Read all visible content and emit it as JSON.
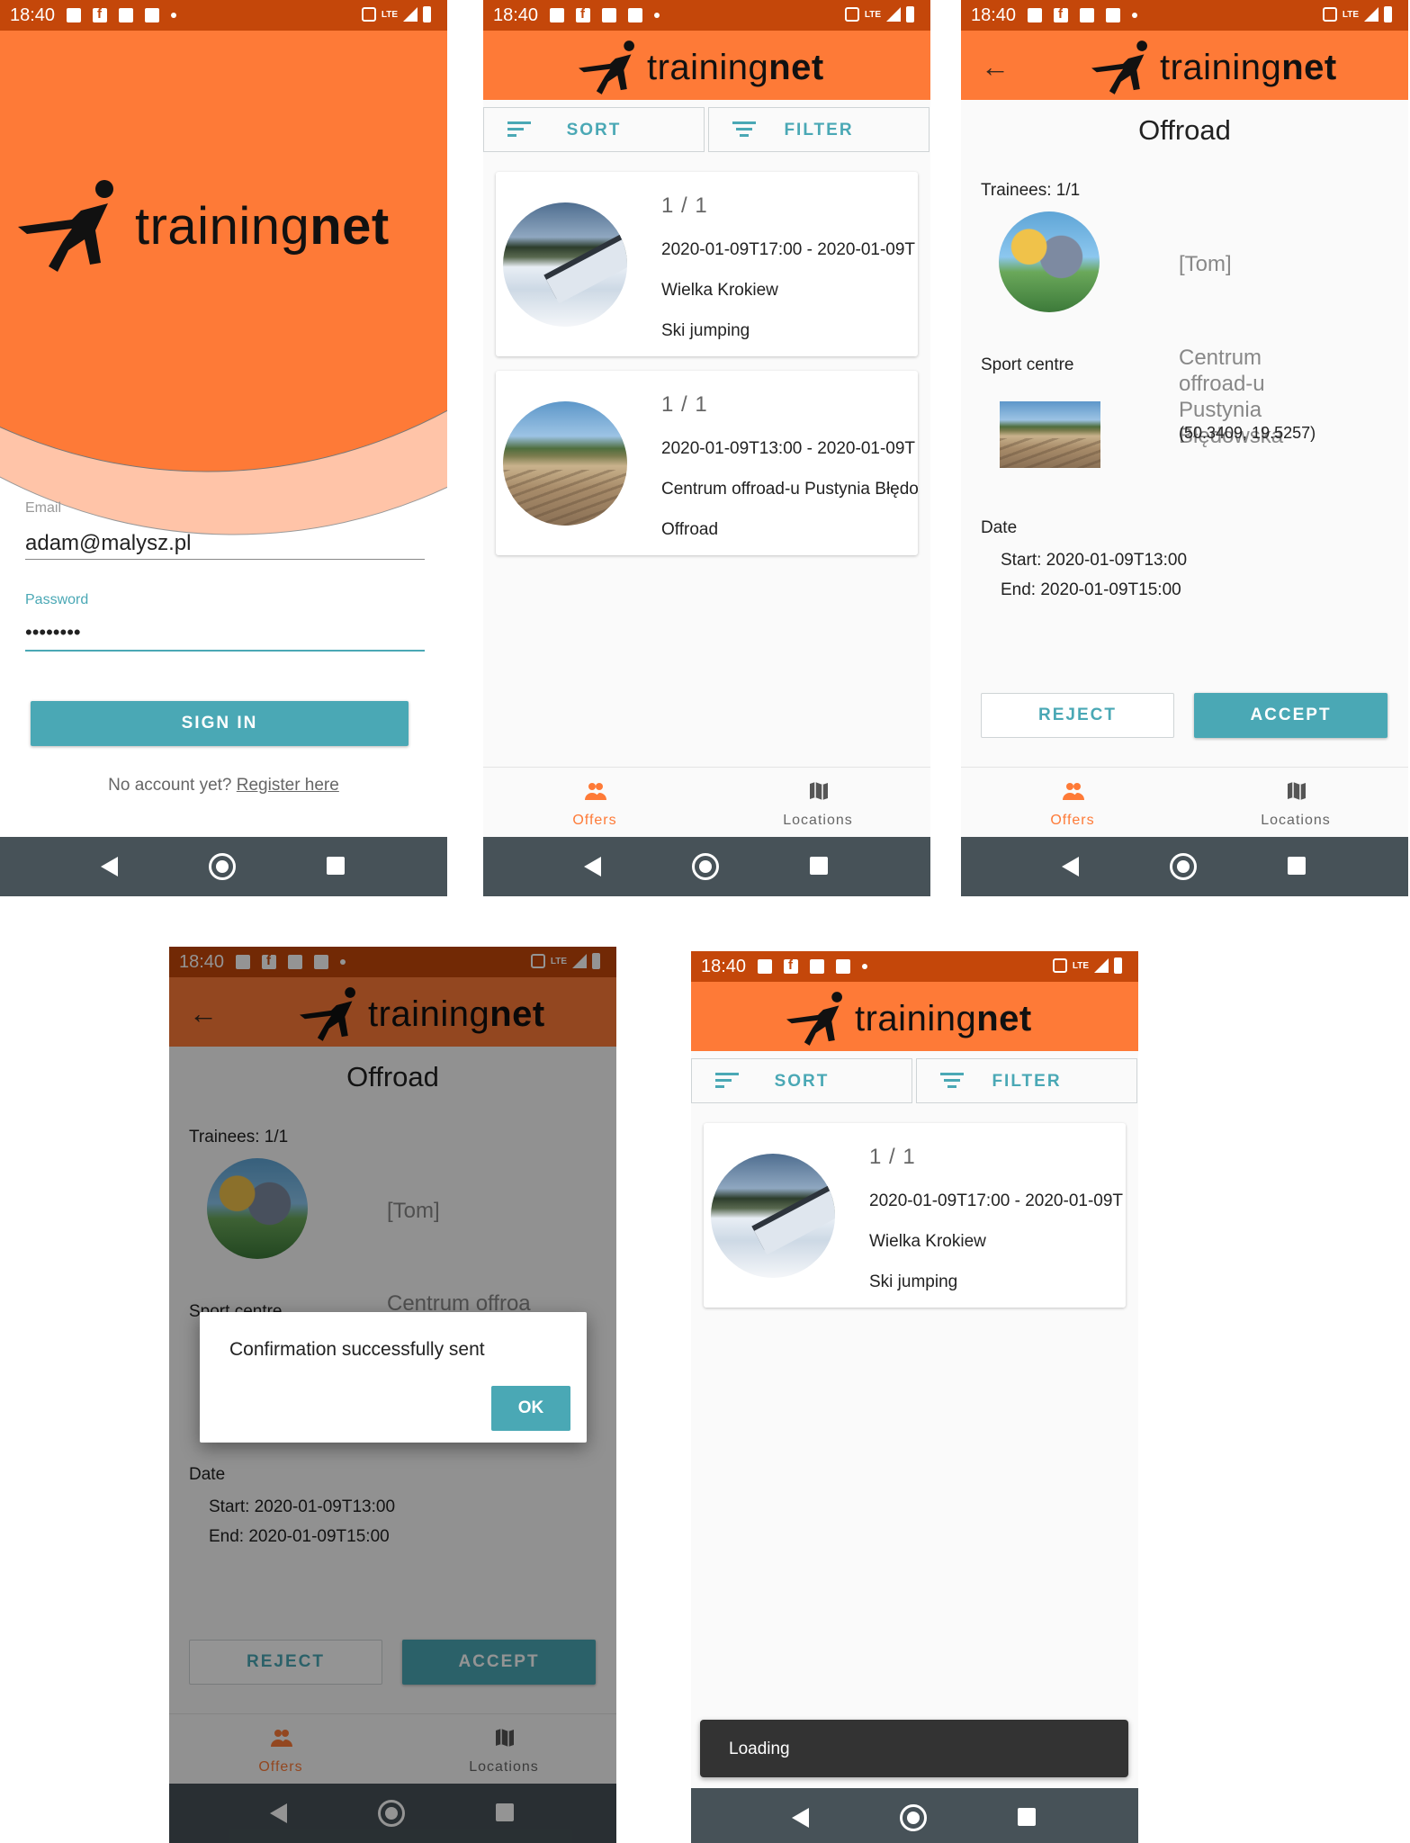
{
  "status": {
    "time": "18:40",
    "network": "LTE"
  },
  "brand": {
    "prefix": "training",
    "suffix": "net"
  },
  "login": {
    "email_label": "Email",
    "email_value": "adam@malysz.pl",
    "password_label": "Password",
    "password_value": "••••••••",
    "sign_in": "SIGN IN",
    "register_prompt": "No account yet?",
    "register_link": "Register here"
  },
  "list": {
    "sort": "SORT",
    "filter": "FILTER",
    "items": [
      {
        "count": "1 / 1",
        "time": "2020-01-09T17:00 - 2020-01-09T",
        "place": "Wielka Krokiew",
        "sport": "Ski jumping",
        "image": "ski-jump-photo"
      },
      {
        "count": "1 / 1",
        "time": "2020-01-09T13:00 - 2020-01-09T",
        "place": "Centrum offroad-u Pustynia Błędo",
        "sport": "Offroad",
        "image": "sand-desert-photo"
      }
    ]
  },
  "detail": {
    "title": "Offroad",
    "trainees_label": "Trainees: 1/1",
    "trainee_name": "[Tom]",
    "sport_centre_label": "Sport centre",
    "centre_name": "Centrum offroad-u Pustynia Błędowska",
    "coords": "(50.3409, 19.5257)",
    "date_label": "Date",
    "start": "Start: 2020-01-09T13:00",
    "end": "End: 2020-01-09T15:00",
    "reject": "REJECT",
    "accept": "ACCEPT"
  },
  "dialog": {
    "message": "Confirmation successfully sent",
    "ok": "OK"
  },
  "toast": {
    "message": "Loading"
  },
  "tabs": {
    "offers": "Offers",
    "locations": "Locations"
  },
  "colors": {
    "primary": "#fe7a37",
    "status_bar": "#c4470a",
    "accent": "#4aa8b5",
    "nav_bar": "#475258"
  }
}
